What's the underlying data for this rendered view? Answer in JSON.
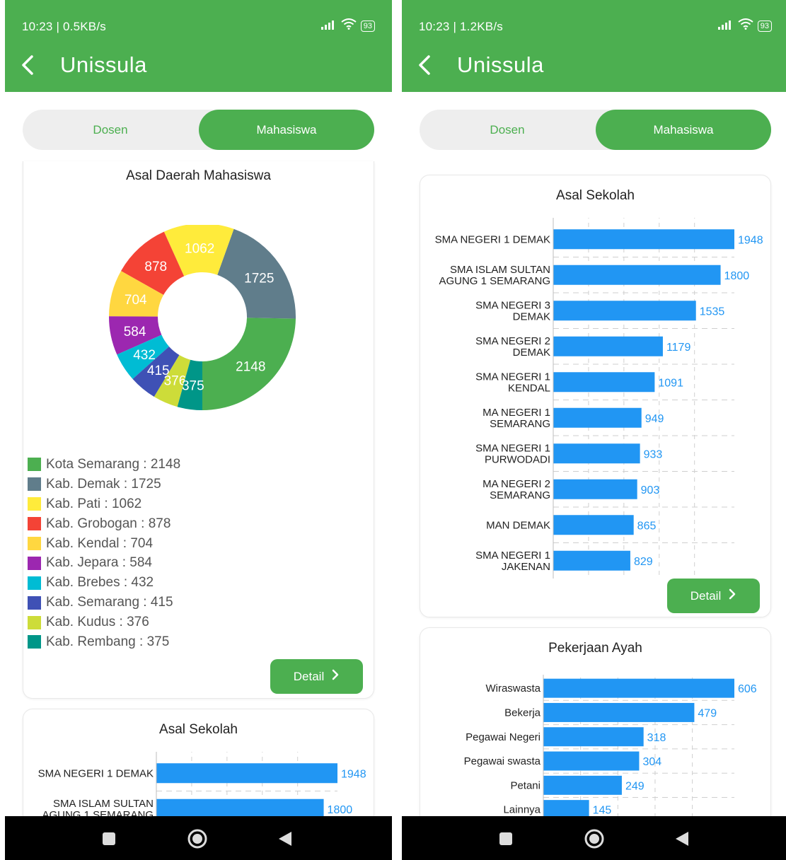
{
  "screens": {
    "left": {
      "status": {
        "time": "10:23 | 0.5KB/s",
        "battery": "93"
      },
      "app_title": "Unissula",
      "tabs": [
        "Dosen",
        "Mahasiswa"
      ],
      "active_tab": "Mahasiswa",
      "card1": {
        "title": "Asal Daerah Mahasiswa",
        "detail_label": "Detail"
      },
      "card2": {
        "title": "Asal Sekolah"
      }
    },
    "right": {
      "status": {
        "time": "10:23 | 1.2KB/s",
        "battery": "93"
      },
      "app_title": "Unissula",
      "tabs": [
        "Dosen",
        "Mahasiswa"
      ],
      "active_tab": "Mahasiswa",
      "card1": {
        "title": "Asal Sekolah",
        "detail_label": "Detail"
      },
      "card2": {
        "title": "Pekerjaan Ayah"
      }
    }
  },
  "colors": {
    "primary": "#4caf50",
    "bar": "#2196f3",
    "bar_value": "#2196f3"
  },
  "icons": [
    "back-arrow-icon",
    "signal-icon",
    "wifi-icon",
    "battery-icon",
    "chevron-right-icon",
    "nav-square-icon",
    "nav-home-icon",
    "nav-back-icon",
    "mute-icon"
  ],
  "chart_data": [
    {
      "id": "asal-daerah",
      "type": "pie",
      "donut": true,
      "title": "Asal Daerah Mahasiswa",
      "legend_position": "bottom",
      "slices": [
        {
          "label": "Kota Semarang",
          "value": 2148,
          "color": "#4caf50",
          "legend_text": "Kota Semarang  : 2148"
        },
        {
          "label": "Kab. Demak",
          "value": 1725,
          "color": "#607d8b",
          "legend_text": "Kab. Demak : 1725"
        },
        {
          "label": "Kab. Pati",
          "value": 1062,
          "color": "#ffeb3b",
          "legend_text": "Kab. Pati  : 1062"
        },
        {
          "label": "Kab. Grobogan",
          "value": 878,
          "color": "#f44336",
          "legend_text": "Kab. Grobogan  : 878"
        },
        {
          "label": "Kab. Kendal",
          "value": 704,
          "color": "#ffd740",
          "legend_text": "Kab. Kendal  : 704"
        },
        {
          "label": "Kab. Jepara",
          "value": 584,
          "color": "#9c27b0",
          "legend_text": "Kab. Jepara  : 584"
        },
        {
          "label": "Kab. Brebes",
          "value": 432,
          "color": "#00bcd4",
          "legend_text": "Kab. Brebes  : 432"
        },
        {
          "label": "Kab. Semarang",
          "value": 415,
          "color": "#3f51b5",
          "legend_text": "Kab. Semarang  : 415"
        },
        {
          "label": "Kab. Kudus",
          "value": 376,
          "color": "#cddc39",
          "legend_text": "Kab. Kudus : 376"
        },
        {
          "label": "Kab. Rembang",
          "value": 375,
          "color": "#009688",
          "legend_text": "Kab. Rembang : 375"
        }
      ]
    },
    {
      "id": "asal-sekolah",
      "type": "bar",
      "orientation": "horizontal",
      "title": "Asal Sekolah",
      "grid": true,
      "categories": [
        [
          "SMA NEGERI  1 DEMAK"
        ],
        [
          "SMA ISLAM SULTAN",
          "AGUNG 1 SEMARANG"
        ],
        [
          "SMA NEGERI  3",
          "DEMAK"
        ],
        [
          "SMA NEGERI  2",
          "DEMAK"
        ],
        [
          "SMA NEGERI  1",
          "KENDAL"
        ],
        [
          "MA NEGERI 1",
          "SEMARANG"
        ],
        [
          "SMA NEGERI  1",
          "PURWODADI"
        ],
        [
          "MA NEGERI 2",
          "SEMARANG"
        ],
        [
          "MAN DEMAK"
        ],
        [
          "SMA NEGERI 1",
          "JAKENAN"
        ]
      ],
      "values": [
        1948,
        1800,
        1535,
        1179,
        1091,
        949,
        933,
        903,
        865,
        829
      ],
      "xlim": [
        0,
        1948
      ]
    },
    {
      "id": "pekerjaan-ayah",
      "type": "bar",
      "orientation": "horizontal",
      "title": "Pekerjaan Ayah",
      "grid": true,
      "categories": [
        [
          "Wiraswasta"
        ],
        [
          "Bekerja"
        ],
        [
          "Pegawai Negeri"
        ],
        [
          "Pegawai swasta"
        ],
        [
          "Petani"
        ],
        [
          "Lainnya"
        ]
      ],
      "values": [
        606,
        479,
        318,
        304,
        249,
        145
      ],
      "xlim": [
        0,
        606
      ]
    }
  ]
}
